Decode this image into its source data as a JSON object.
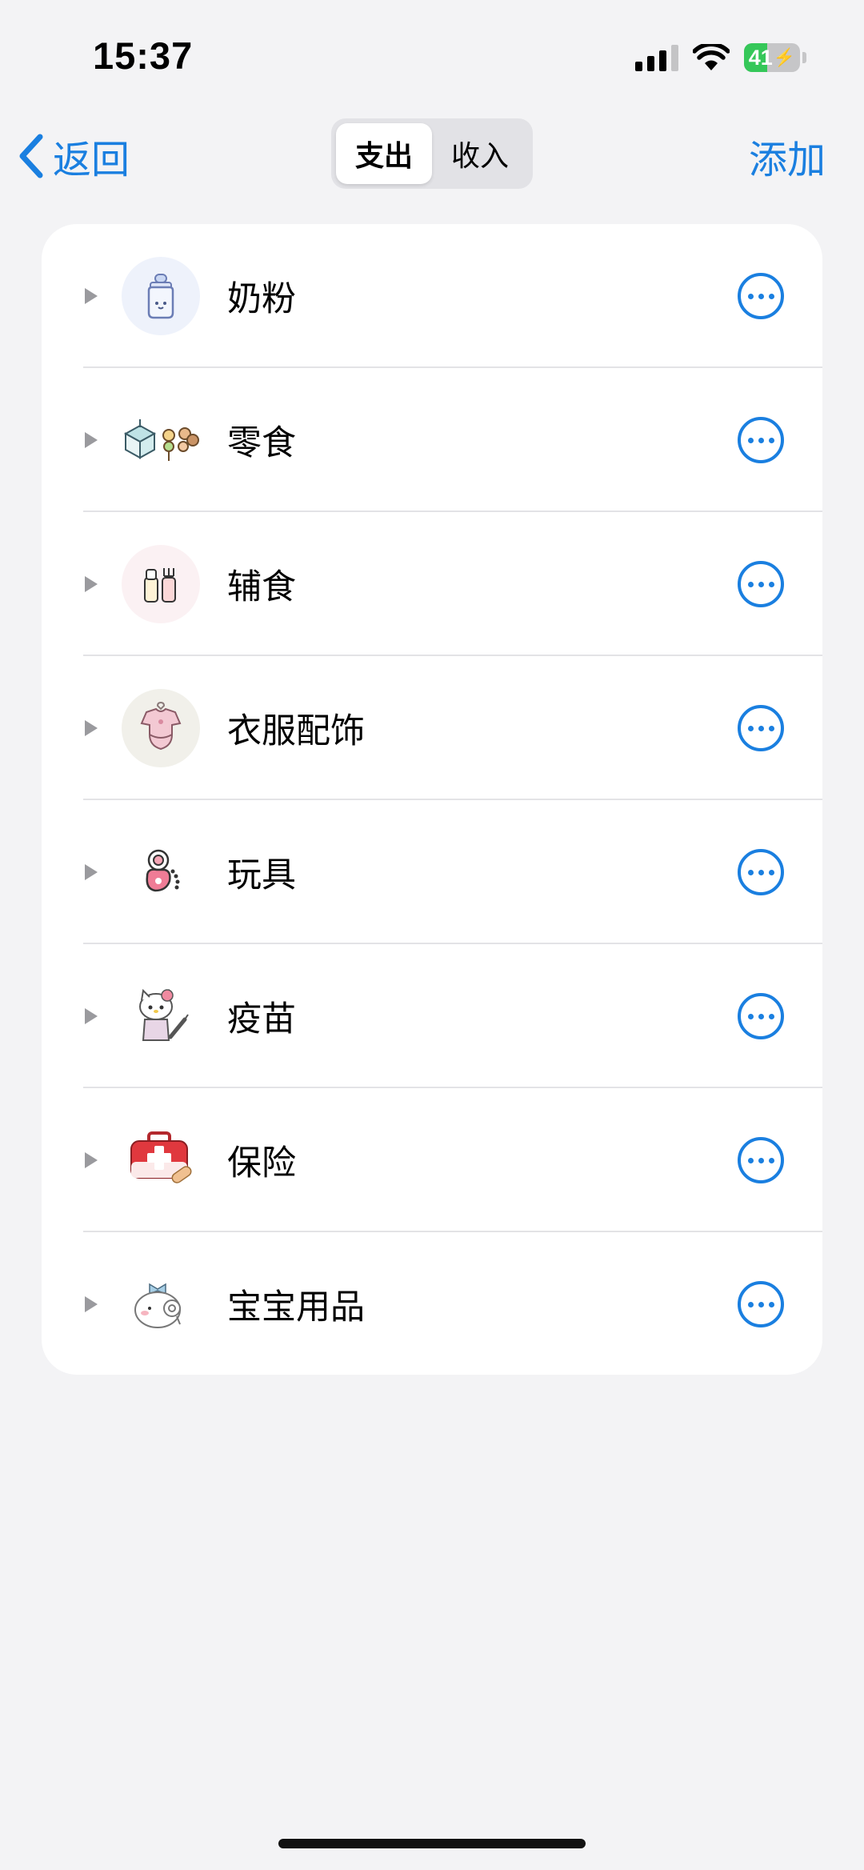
{
  "status_bar": {
    "time": "15:37",
    "battery": "41"
  },
  "nav": {
    "back_label": "返回",
    "add_label": "添加",
    "segments": [
      {
        "label": "支出",
        "selected": true
      },
      {
        "label": "收入",
        "selected": false
      }
    ]
  },
  "categories": [
    {
      "label": "奶粉",
      "icon": "milk-bottle-icon"
    },
    {
      "label": "零食",
      "icon": "snack-icon"
    },
    {
      "label": "辅食",
      "icon": "baby-food-icon"
    },
    {
      "label": "衣服配饰",
      "icon": "baby-clothes-icon"
    },
    {
      "label": "玩具",
      "icon": "toy-icon"
    },
    {
      "label": "疫苗",
      "icon": "vaccine-kitty-icon"
    },
    {
      "label": "保险",
      "icon": "first-aid-kit-icon"
    },
    {
      "label": "宝宝用品",
      "icon": "baby-supplies-icon"
    }
  ],
  "colors": {
    "accent": "#1a7fe0",
    "battery_green": "#35c759"
  }
}
